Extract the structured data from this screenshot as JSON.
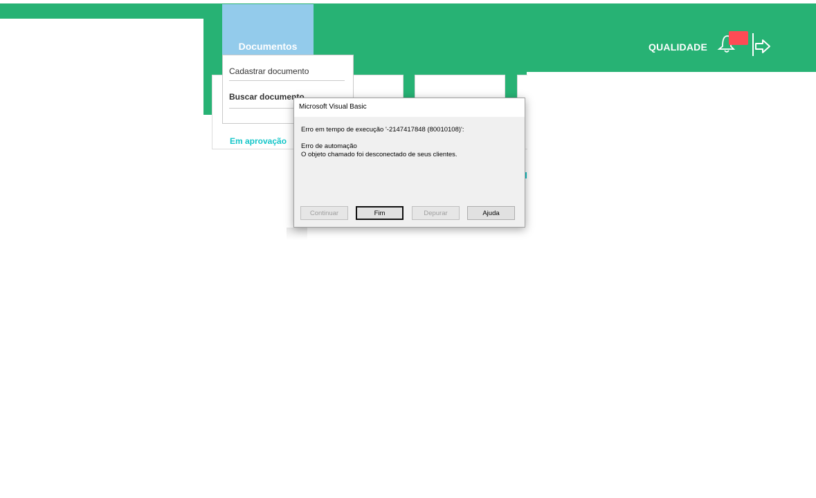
{
  "nav": {
    "active_tab": "Documentos",
    "dropdown_items": [
      "Cadastrar documento",
      "Buscar documento"
    ]
  },
  "header": {
    "brand": "QUALIDADE",
    "bell_icon": "bell-icon",
    "logout_icon": "logout-arrow-icon"
  },
  "cards": {
    "first_label": "Em aprovação"
  },
  "dialog": {
    "title": "Microsoft Visual Basic",
    "error_line": "Erro em tempo de execução '-2147417848 (80010108)':",
    "message_line1": "Erro de automação",
    "message_line2": "O objeto chamado foi desconectado de seus clientes.",
    "buttons": {
      "continue": "Continuar",
      "end": "Fim",
      "debug": "Depurar",
      "help": "Ajuda"
    }
  },
  "colors": {
    "header_green": "#27b274",
    "tab_blue": "#93cbeb",
    "badge_red": "#ff4b55",
    "accent_teal": "#15c6c9"
  }
}
